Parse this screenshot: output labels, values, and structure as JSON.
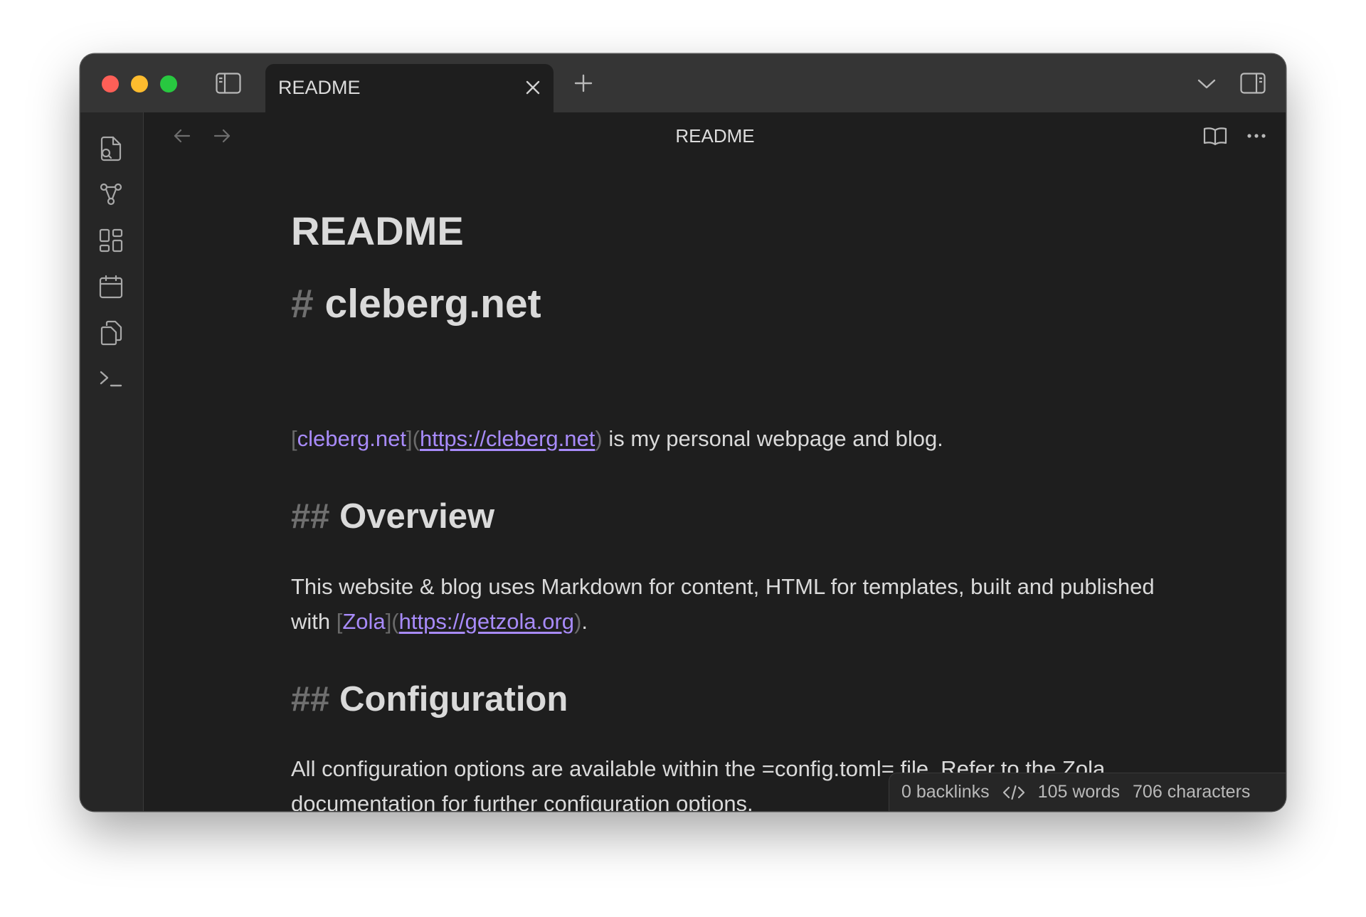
{
  "window": {
    "tab_title": "README",
    "view_title": "README"
  },
  "ribbon": {
    "items": [
      {
        "icon": "new-note-icon"
      },
      {
        "icon": "graph-view-icon"
      },
      {
        "icon": "canvas-icon"
      },
      {
        "icon": "daily-note-calendar-icon"
      },
      {
        "icon": "templates-icon"
      },
      {
        "icon": "command-palette-icon"
      }
    ]
  },
  "document": {
    "inline_title": "README",
    "h1": {
      "marker": "#",
      "text": "cleberg.net"
    },
    "intro": {
      "open_bracket": "[",
      "link_text": "cleberg.net",
      "mid": "](",
      "url": "https://cleberg.net",
      "close_paren": ")",
      "rest": " is my personal webpage and blog."
    },
    "overview": {
      "marker": "##",
      "text": "Overview"
    },
    "overview_para": {
      "text_before": "This website & blog uses Markdown for content, HTML for templates, built and published with ",
      "open_bracket": "[",
      "link_text": "Zola",
      "mid": "](",
      "url": "https://getzola.org",
      "close_paren": ")",
      "rest": "."
    },
    "configuration": {
      "marker": "##",
      "text": "Configuration"
    },
    "configuration_para": "All configuration options are available within the =config.toml= file. Refer to the Zola documentation for further configuration options."
  },
  "status": {
    "backlinks": "0 backlinks",
    "words": "105 words",
    "characters": "706 characters"
  },
  "colors": {
    "background": "#1e1e1e",
    "titlebar": "#353535",
    "accent_link": "#a88bfa",
    "text": "#dadada",
    "muted": "#6f6f6f"
  }
}
